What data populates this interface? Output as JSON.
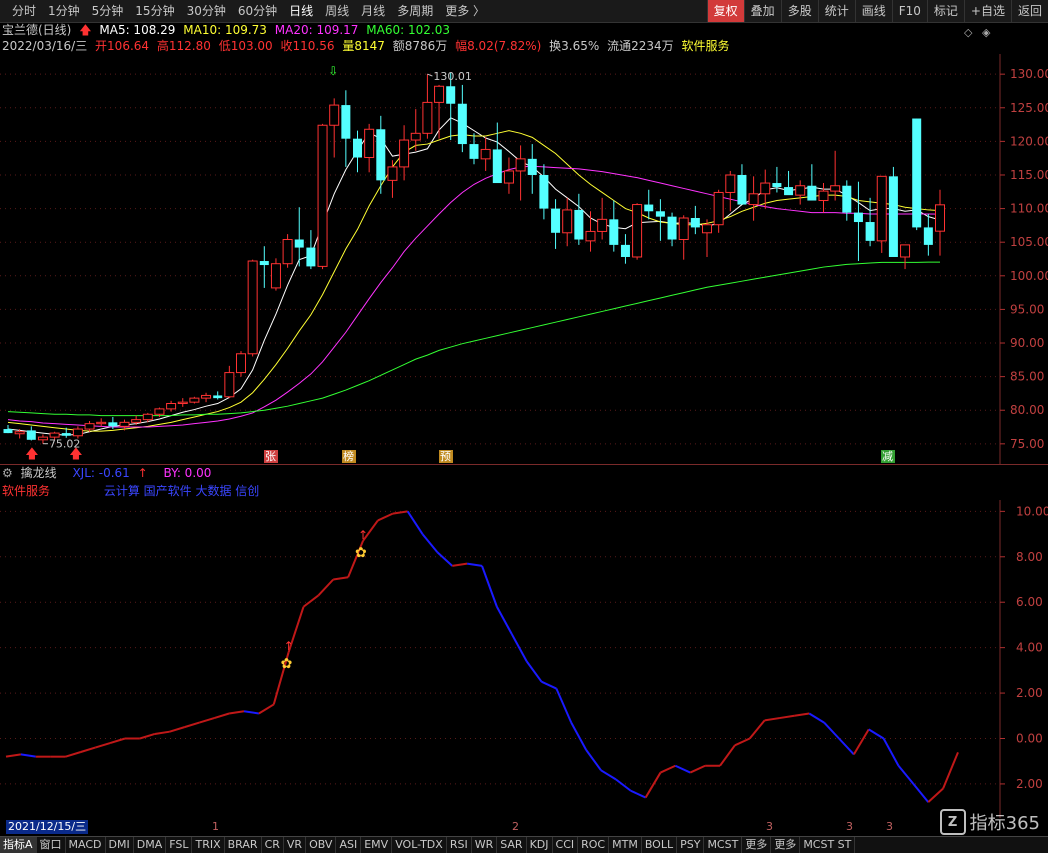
{
  "topbar": {
    "tabs": [
      "分时",
      "1分钟",
      "5分钟",
      "15分钟",
      "30分钟",
      "60分钟",
      "日线",
      "周线",
      "月线",
      "多周期",
      "更多 〉"
    ],
    "active_tab": "日线",
    "tools": [
      "复权",
      "叠加",
      "多股",
      "统计",
      "画线",
      "F10",
      "标记",
      "+自选",
      "返回"
    ],
    "active_tool": "复权"
  },
  "header": {
    "title": "宝兰德(日线)",
    "ma5": "MA5: 108.29",
    "ma10": "MA10: 109.73",
    "ma20": "MA20: 109.17",
    "ma60": "MA60: 102.03",
    "date": "2022/03/16/三",
    "open": "开106.64",
    "high": "高112.80",
    "low": "低103.00",
    "close": "收110.56",
    "volume": "量8147",
    "amount": "额8786万",
    "range": "幅8.02(7.82%)",
    "turnover": "换3.65%",
    "float": "流通2234万",
    "sector": "软件服务",
    "colors": {
      "ma5": "#ffffff",
      "ma10": "#ffff33",
      "ma20": "#ff33ff",
      "ma60": "#33ff33",
      "up": "#ff3232",
      "down": "#54ffff"
    }
  },
  "price_labels": {
    "high_mark": "130.01",
    "low_mark": "75.02"
  },
  "markers": [
    "张",
    "榜",
    "预",
    "减"
  ],
  "subheader": {
    "title": "擒龙线",
    "xjl": "XJL: -0.61",
    "by": "BY: 0.00",
    "sector": "软件服务",
    "concepts": "云计算 国产软件 大数据 信创"
  },
  "date_box": "2021/12/15/三",
  "month_marks": [
    "1",
    "2",
    "3",
    "3",
    "3"
  ],
  "bottombar": [
    "指标A",
    "窗口",
    "MACD",
    "DMI",
    "DMA",
    "FSL",
    "TRIX",
    "BRAR",
    "CR",
    "VR",
    "OBV",
    "ASI",
    "EMV",
    "VOL-TDX",
    "RSI",
    "WR",
    "SAR",
    "KDJ",
    "CCI",
    "ROC",
    "MTM",
    "BOLL",
    "PSY",
    "MCST",
    "更多",
    "更多",
    "MCST ST"
  ],
  "logo": {
    "text": "指标365"
  },
  "chart_data": [
    {
      "type": "candlestick",
      "title": "宝兰德(日线)",
      "ylim": [
        72,
        133
      ],
      "yticks": [
        75,
        80,
        85,
        90,
        95,
        100,
        105,
        110,
        115,
        120,
        125,
        130
      ],
      "candles": [
        [
          77.2,
          77.8,
          76.6,
          76.6
        ],
        [
          76.5,
          77.2,
          75.8,
          76.8
        ],
        [
          77.0,
          77.6,
          75.5,
          75.6
        ],
        [
          75.6,
          76.4,
          75.0,
          76.0
        ],
        [
          76.0,
          76.8,
          75.6,
          76.6
        ],
        [
          76.6,
          77.4,
          75.9,
          76.2
        ],
        [
          76.2,
          77.6,
          75.8,
          77.2
        ],
        [
          77.2,
          78.4,
          76.8,
          78.0
        ],
        [
          78.0,
          78.8,
          77.6,
          78.2
        ],
        [
          78.2,
          79.0,
          77.2,
          77.6
        ],
        [
          77.6,
          78.6,
          77.0,
          78.2
        ],
        [
          78.2,
          79.2,
          77.8,
          78.6
        ],
        [
          78.6,
          79.6,
          78.2,
          79.4
        ],
        [
          79.4,
          80.4,
          79.0,
          80.2
        ],
        [
          80.2,
          81.4,
          79.8,
          81.0
        ],
        [
          81.0,
          81.8,
          80.5,
          81.2
        ],
        [
          81.2,
          82.0,
          81.0,
          81.8
        ],
        [
          81.8,
          82.6,
          81.2,
          82.2
        ],
        [
          82.2,
          82.8,
          81.6,
          81.8
        ],
        [
          82.0,
          86.6,
          81.8,
          85.6
        ],
        [
          85.6,
          88.8,
          85.0,
          88.4
        ],
        [
          88.4,
          102.4,
          88.0,
          102.2
        ],
        [
          102.2,
          104.4,
          98.2,
          101.6
        ],
        [
          98.2,
          102.6,
          97.8,
          101.8
        ],
        [
          101.8,
          106.2,
          101.2,
          105.4
        ],
        [
          105.4,
          110.2,
          101.4,
          104.2
        ],
        [
          104.2,
          106.8,
          101.0,
          101.4
        ],
        [
          101.4,
          122.6,
          101.0,
          122.4
        ],
        [
          122.4,
          126.4,
          117.6,
          125.4
        ],
        [
          125.4,
          127.6,
          116.2,
          120.4
        ],
        [
          120.4,
          121.6,
          115.4,
          117.6
        ],
        [
          117.6,
          122.6,
          115.4,
          121.8
        ],
        [
          121.8,
          123.8,
          112.2,
          114.2
        ],
        [
          114.2,
          117.2,
          111.6,
          116.2
        ],
        [
          116.2,
          122.4,
          114.2,
          120.2
        ],
        [
          120.2,
          124.8,
          118.6,
          121.2
        ],
        [
          121.2,
          130.01,
          120.4,
          125.8
        ],
        [
          125.8,
          128.4,
          120.4,
          128.2
        ],
        [
          128.2,
          130.2,
          120.2,
          125.6
        ],
        [
          125.6,
          128.4,
          118.4,
          119.6
        ],
        [
          119.6,
          121.2,
          116.6,
          117.4
        ],
        [
          117.4,
          120.6,
          115.6,
          118.8
        ],
        [
          118.8,
          122.8,
          115.2,
          113.8
        ],
        [
          113.8,
          117.6,
          112.2,
          115.6
        ],
        [
          115.6,
          119.4,
          111.2,
          117.4
        ],
        [
          117.4,
          119.6,
          112.2,
          115.0
        ],
        [
          115.0,
          116.6,
          108.4,
          110.0
        ],
        [
          110.0,
          111.4,
          104.0,
          106.4
        ],
        [
          106.4,
          111.6,
          104.4,
          109.8
        ],
        [
          109.8,
          112.2,
          104.6,
          105.4
        ],
        [
          105.2,
          109.6,
          103.6,
          106.6
        ],
        [
          106.6,
          111.6,
          105.4,
          108.4
        ],
        [
          108.4,
          111.2,
          103.6,
          104.6
        ],
        [
          104.6,
          106.2,
          101.8,
          102.8
        ],
        [
          102.8,
          110.8,
          102.4,
          110.6
        ],
        [
          110.6,
          112.8,
          108.4,
          109.6
        ],
        [
          109.6,
          111.4,
          105.2,
          108.8
        ],
        [
          108.8,
          109.4,
          104.4,
          105.4
        ],
        [
          105.4,
          109.0,
          102.4,
          108.6
        ],
        [
          108.6,
          110.4,
          106.2,
          107.2
        ],
        [
          106.4,
          108.4,
          102.8,
          107.6
        ],
        [
          107.6,
          112.8,
          106.4,
          112.4
        ],
        [
          112.4,
          115.6,
          109.6,
          115.0
        ],
        [
          115.0,
          116.6,
          112.2,
          110.6
        ],
        [
          110.6,
          114.8,
          108.2,
          112.2
        ],
        [
          112.2,
          115.8,
          110.0,
          113.8
        ],
        [
          113.8,
          116.2,
          112.4,
          113.2
        ],
        [
          113.2,
          115.6,
          112.6,
          112.0
        ],
        [
          112.0,
          114.2,
          110.6,
          113.4
        ],
        [
          113.4,
          116.6,
          111.4,
          111.2
        ],
        [
          111.2,
          113.8,
          109.4,
          112.6
        ],
        [
          112.6,
          118.6,
          111.2,
          113.4
        ],
        [
          113.4,
          114.2,
          108.2,
          109.4
        ],
        [
          109.4,
          114.0,
          102.2,
          108.0
        ],
        [
          108.0,
          111.6,
          104.4,
          105.2
        ],
        [
          105.2,
          108.4,
          103.4,
          114.8
        ],
        [
          114.8,
          116.2,
          108.4,
          102.8
        ],
        [
          102.8,
          104.6,
          101.0,
          104.6
        ],
        [
          123.4,
          123.4,
          106.8,
          107.2
        ],
        [
          107.2,
          109.2,
          103.0,
          104.6
        ],
        [
          106.64,
          112.8,
          103.0,
          110.56
        ]
      ],
      "series": [
        {
          "name": "MA5",
          "color": "#ffffff",
          "values": [
            77.2,
            77.0,
            76.8,
            76.6,
            76.4,
            76.3,
            76.4,
            76.8,
            77.2,
            77.6,
            77.8,
            78.0,
            78.3,
            78.7,
            79.2,
            79.7,
            80.1,
            80.6,
            81.0,
            81.9,
            83.2,
            86.0,
            90.4,
            94.3,
            98.6,
            102.4,
            103.0,
            107.7,
            112.2,
            115.8,
            118.6,
            121.3,
            120.4,
            117.8,
            118.1,
            118.4,
            118.9,
            121.7,
            123.5,
            122.7,
            121.6,
            120.5,
            119.9,
            118.5,
            117.0,
            116.2,
            114.7,
            112.9,
            111.6,
            110.3,
            108.6,
            107.7,
            107.2,
            107.0,
            107.9,
            108.0,
            108.1,
            107.8,
            107.9,
            107.8,
            107.4,
            107.8,
            109.2,
            110.6,
            111.5,
            112.8,
            113.1,
            112.7,
            112.9,
            113.2,
            112.9,
            112.9,
            112.0,
            110.9,
            109.7,
            110.0,
            110.0,
            109.6,
            109.8,
            108.8,
            108.3
          ]
        },
        {
          "name": "MA10",
          "color": "#ffff33",
          "values": [
            78.2,
            78.0,
            77.8,
            77.6,
            77.4,
            77.2,
            77.0,
            76.9,
            76.9,
            77.0,
            77.2,
            77.4,
            77.6,
            77.9,
            78.2,
            78.6,
            79.0,
            79.4,
            79.8,
            80.4,
            81.2,
            82.6,
            84.6,
            86.8,
            89.2,
            91.8,
            94.2,
            97.2,
            100.6,
            104.0,
            106.9,
            110.4,
            113.4,
            116.2,
            118.4,
            119.4,
            119.6,
            120.2,
            120.8,
            121.0,
            120.8,
            120.8,
            121.2,
            121.6,
            121.2,
            120.6,
            119.4,
            118.2,
            116.6,
            115.0,
            113.6,
            112.4,
            111.2,
            110.0,
            109.4,
            108.6,
            108.0,
            107.8,
            107.6,
            107.6,
            107.8,
            108.2,
            108.8,
            109.6,
            110.2,
            110.8,
            111.2,
            111.4,
            111.6,
            111.8,
            112.0,
            112.0,
            111.8,
            111.2,
            111.0,
            110.8,
            110.6,
            110.2,
            110.0,
            109.8,
            109.7
          ]
        },
        {
          "name": "MA20",
          "color": "#ff33ff",
          "values": [
            78.6,
            78.4,
            78.3,
            78.1,
            78.0,
            77.9,
            77.8,
            77.7,
            77.6,
            77.5,
            77.5,
            77.5,
            77.5,
            77.6,
            77.7,
            77.8,
            78.0,
            78.2,
            78.4,
            78.7,
            79.1,
            79.6,
            80.5,
            81.5,
            82.7,
            84.0,
            85.4,
            87.2,
            89.4,
            91.6,
            94.1,
            96.6,
            99.0,
            101.2,
            103.6,
            105.6,
            107.4,
            109.2,
            110.9,
            112.4,
            113.6,
            114.5,
            115.2,
            115.8,
            116.2,
            116.3,
            116.2,
            116.1,
            116.0,
            115.9,
            115.7,
            115.5,
            115.2,
            114.9,
            114.6,
            114.2,
            113.8,
            113.4,
            113.0,
            112.6,
            112.2,
            111.8,
            111.4,
            111.0,
            110.6,
            110.3,
            110.0,
            109.8,
            109.6,
            109.4,
            109.4,
            109.4,
            109.3,
            109.3,
            109.2,
            109.2,
            109.2,
            109.2,
            109.2,
            109.2,
            109.17
          ]
        },
        {
          "name": "MA60",
          "color": "#33ff33",
          "values": [
            79.8,
            79.7,
            79.6,
            79.5,
            79.4,
            79.4,
            79.3,
            79.3,
            79.2,
            79.2,
            79.2,
            79.2,
            79.2,
            79.2,
            79.2,
            79.3,
            79.3,
            79.4,
            79.4,
            79.5,
            79.6,
            79.8,
            80.0,
            80.3,
            80.6,
            81.0,
            81.4,
            81.8,
            82.4,
            83.0,
            83.7,
            84.4,
            85.2,
            86.0,
            86.8,
            87.6,
            88.2,
            88.9,
            89.4,
            89.9,
            90.3,
            90.7,
            91.1,
            91.5,
            91.9,
            92.3,
            92.7,
            93.1,
            93.5,
            93.9,
            94.3,
            94.7,
            95.1,
            95.5,
            95.9,
            96.3,
            96.7,
            97.1,
            97.5,
            97.9,
            98.3,
            98.6,
            98.9,
            99.2,
            99.5,
            99.8,
            100.1,
            100.4,
            100.7,
            101.0,
            101.3,
            101.5,
            101.7,
            101.8,
            101.9,
            102.0,
            102.0,
            102.0,
            102.0,
            102.03,
            102.03
          ]
        }
      ]
    },
    {
      "type": "line",
      "title": "擒龙线",
      "ylim": [
        -3.5,
        10.5
      ],
      "yticks": [
        -2,
        0,
        2,
        4,
        6,
        8,
        10
      ],
      "series": [
        {
          "name": "XJL",
          "values": [
            -0.8,
            -0.7,
            -0.8,
            -0.8,
            -0.8,
            -0.6,
            -0.4,
            -0.2,
            0.0,
            0.0,
            0.2,
            0.3,
            0.5,
            0.7,
            0.9,
            1.1,
            1.2,
            1.1,
            1.5,
            3.8,
            5.8,
            6.3,
            7.0,
            7.1,
            8.7,
            9.6,
            9.9,
            10.0,
            9.0,
            8.2,
            7.6,
            7.7,
            7.6,
            5.8,
            4.6,
            3.4,
            2.5,
            2.2,
            0.7,
            -0.5,
            -1.4,
            -1.8,
            -2.3,
            -2.6,
            -1.5,
            -1.2,
            -1.5,
            -1.2,
            -1.2,
            -0.3,
            0.0,
            0.8,
            0.9,
            1.0,
            1.1,
            0.7,
            0.0,
            -0.7,
            0.4,
            0.0,
            -1.2,
            -2.0,
            -2.8,
            -2.2,
            -0.61
          ]
        }
      ]
    }
  ]
}
